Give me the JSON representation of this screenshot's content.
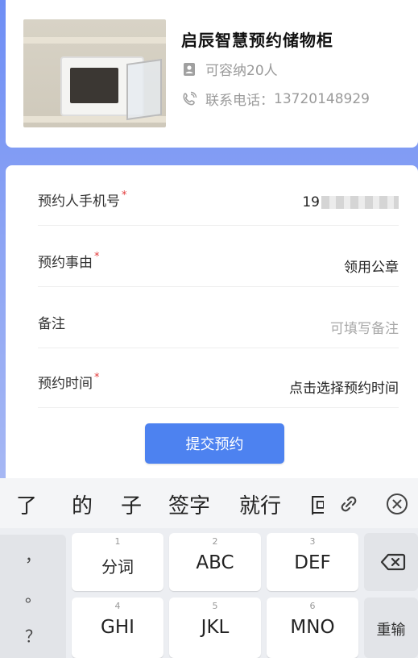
{
  "store": {
    "name": "启辰智慧预约储物柜",
    "capacity": "可容纳20人",
    "phone_label": "联系电话：",
    "phone": "13720148929",
    "icons": [
      "person-card-icon",
      "phone-icon"
    ]
  },
  "form": {
    "phone": {
      "label": "预约人手机号",
      "required": "*",
      "value": "19"
    },
    "reason": {
      "label": "预约事由",
      "required": "*",
      "value": "领用公章"
    },
    "note": {
      "label": "备注",
      "placeholder": "可填写备注"
    },
    "time": {
      "label": "预约时间",
      "required": "*",
      "value": "点击选择预约时间"
    },
    "submit": "提交预约"
  },
  "keyboard": {
    "candidates": [
      "了",
      "的",
      "子",
      "签字",
      "就行",
      "回"
    ],
    "candidate_icons": [
      "link-icon",
      "close-circle-icon"
    ],
    "side_keys": [
      "，",
      "。",
      "？"
    ],
    "keys": [
      {
        "num": "1",
        "label": "分词"
      },
      {
        "num": "2",
        "label": "ABC"
      },
      {
        "num": "3",
        "label": "DEF"
      },
      {
        "num": "4",
        "label": "GHI"
      },
      {
        "num": "5",
        "label": "JKL"
      },
      {
        "num": "6",
        "label": "MNO"
      }
    ],
    "backspace_icon": "backspace-icon",
    "reenter": "重输"
  },
  "colors": {
    "accent": "#4d82f0",
    "required": "#e23b3b",
    "background": "#6e8ef5"
  }
}
